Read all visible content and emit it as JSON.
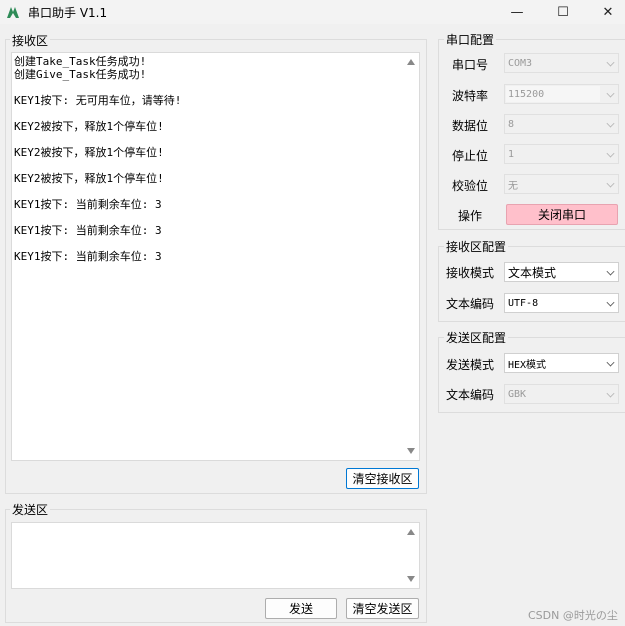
{
  "window": {
    "title": "串口助手 V1.1",
    "minimize_glyph": "—",
    "maximize_glyph": "☐",
    "close_glyph": "✕",
    "app_icon": "green-logo-icon",
    "accent_color": "#2e8b57"
  },
  "receive": {
    "group_title": "接收区",
    "lines": [
      "创建Take_Task任务成功!",
      "创建Give_Task任务成功!",
      "",
      "KEY1按下: 无可用车位，请等待!",
      "",
      "KEY2被按下，释放1个停车位!",
      "",
      "KEY2被按下，释放1个停车位!",
      "",
      "KEY2被按下，释放1个停车位!",
      "",
      "KEY1按下: 当前剩余车位: 3",
      "",
      "KEY1按下: 当前剩余车位: 3",
      "",
      "KEY1按下: 当前剩余车位: 3"
    ],
    "clear_button": "清空接收区"
  },
  "send": {
    "group_title": "发送区",
    "text": "",
    "send_button": "发送",
    "clear_button": "清空发送区"
  },
  "serial_config": {
    "group_title": "串口配置",
    "port_label": "串口号",
    "port_value": "COM3",
    "baud_label": "波特率",
    "baud_value": "115200",
    "databits_label": "数据位",
    "databits_value": "8",
    "stopbits_label": "停止位",
    "stopbits_value": "1",
    "parity_label": "校验位",
    "parity_value": "无",
    "action_label": "操作",
    "action_button": "关闭串口",
    "action_button_color": "#ffc0cb"
  },
  "receive_config": {
    "group_title": "接收区配置",
    "mode_label": "接收模式",
    "mode_value": "文本模式",
    "encoding_label": "文本编码",
    "encoding_value": "UTF-8"
  },
  "send_config": {
    "group_title": "发送区配置",
    "mode_label": "发送模式",
    "mode_value": "HEX模式",
    "encoding_label": "文本编码",
    "encoding_value": "GBK"
  },
  "watermark": "CSDN @时光の尘"
}
